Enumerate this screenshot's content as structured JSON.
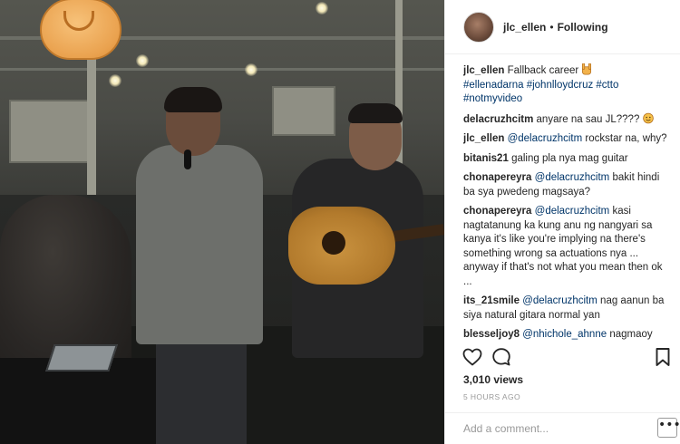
{
  "post": {
    "username": "jlc_ellen",
    "separator": "•",
    "follow_status": "Following"
  },
  "caption": {
    "username": "jlc_ellen",
    "text": "Fallback career",
    "emoji": "rock-hand-emoji",
    "hashtags": "#ellenadarna #johnlloydcruz #ctto #notmyvideo"
  },
  "comments": [
    {
      "user": "delacruzhcitm",
      "mention": "",
      "text": "anyare na sau JL????",
      "emoji": "smile-emoji"
    },
    {
      "user": "jlc_ellen",
      "mention": "@delacruzhcitm",
      "text": "rockstar na, why?",
      "emoji": ""
    },
    {
      "user": "bitanis21",
      "mention": "",
      "text": "galing pla nya mag guitar",
      "emoji": ""
    },
    {
      "user": "chonapereyra",
      "mention": "@delacruzhcitm",
      "text": "bakit hindi ba sya pwedeng magsaya?",
      "emoji": ""
    },
    {
      "user": "chonapereyra",
      "mention": "@delacruzhcitm",
      "text": "kasi nagtatanung ka kung anu ng nangyari sa kanya it's like you're implying na there's something wrong sa actuations nya ... anyway if that's not what you mean then ok ...",
      "emoji": ""
    },
    {
      "user": "its_21smile",
      "mention": "@delacruzhcitm",
      "text": "nag aanun ba siya natural gitara normal yan",
      "emoji": ""
    },
    {
      "user": "blesseljoy8",
      "mention": "@nhichole_ahnne",
      "text": "nagmaoy haha",
      "emoji": ""
    }
  ],
  "actions": {
    "like_icon": "heart-icon",
    "comment_icon": "comment-bubble-icon",
    "save_icon": "bookmark-icon"
  },
  "stats": {
    "views": "3,010 views",
    "timestamp": "5 HOURS AGO"
  },
  "add_comment": {
    "placeholder": "Add a comment...",
    "more_label": "•••"
  },
  "colors": {
    "link": "#003569",
    "text": "#262626",
    "muted": "#999999",
    "border": "#efefef"
  }
}
